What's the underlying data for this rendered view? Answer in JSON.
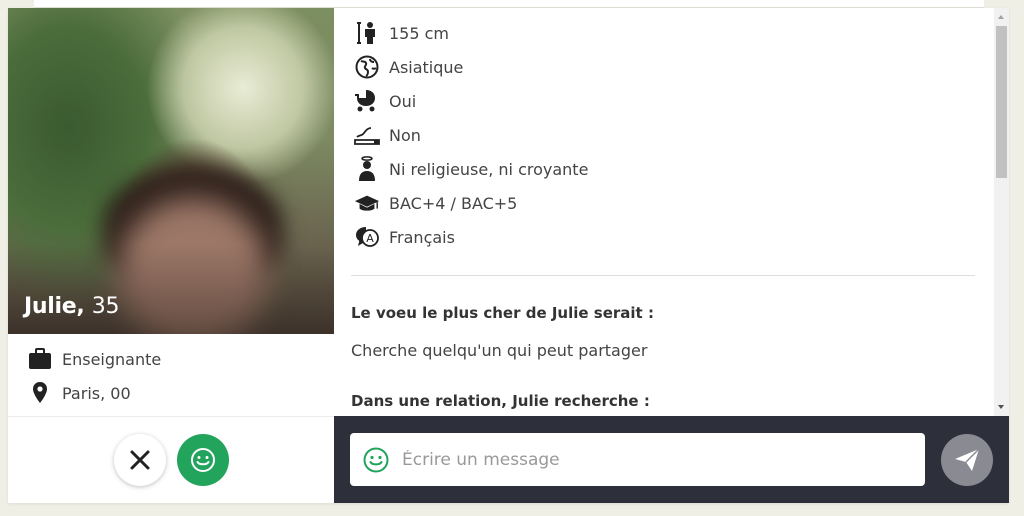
{
  "profile": {
    "name": "Julie,",
    "age": "35",
    "job": "Enseignante",
    "location": "Paris, 00",
    "photo_alt": "Photo de profil floutée"
  },
  "attributes": [
    {
      "icon": "height-icon",
      "text": "155 cm"
    },
    {
      "icon": "globe-icon",
      "text": "Asiatique"
    },
    {
      "icon": "stroller-icon",
      "text": "Oui"
    },
    {
      "icon": "cigarette-icon",
      "text": "Non"
    },
    {
      "icon": "religion-icon",
      "text": "Ni religieuse, ni croyante"
    },
    {
      "icon": "graduation-cap-icon",
      "text": "BAC+4 / BAC+5"
    },
    {
      "icon": "language-bubble-icon",
      "text": "Français"
    }
  ],
  "sections": [
    {
      "question": "Le voeu le plus cher de Julie serait :",
      "answer": "Cherche quelqu'un qui peut partager"
    },
    {
      "question": "Dans une relation, Julie recherche :",
      "answer": ""
    }
  ],
  "message": {
    "placeholder": "Écrire un message",
    "value": ""
  },
  "colors": {
    "accent_green": "#22a45d",
    "message_bar": "#2d2f3b",
    "send_button": "#8a8b92"
  }
}
